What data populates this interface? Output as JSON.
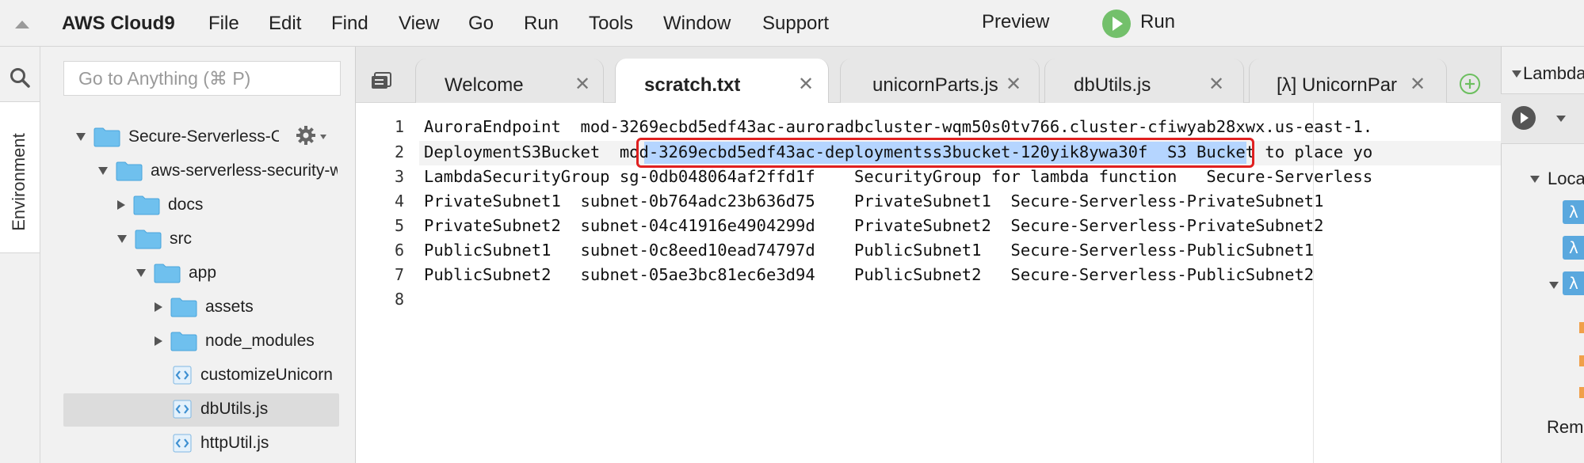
{
  "menubar": {
    "app_title": "AWS Cloud9",
    "items": [
      "File",
      "Edit",
      "Find",
      "View",
      "Go",
      "Run",
      "Tools",
      "Window",
      "Support"
    ],
    "preview_label": "Preview",
    "run_label": "Run"
  },
  "sidebar": {
    "environment_tab": "Environment",
    "goto_placeholder": "Go to Anything (⌘ P)",
    "tree": [
      {
        "label": "Secure-Serverless-C",
        "type": "folder",
        "state": "expanded"
      },
      {
        "label": "aws-serverless-security-w",
        "type": "folder",
        "state": "expanded"
      },
      {
        "label": "docs",
        "type": "folder",
        "state": "collapsed"
      },
      {
        "label": "src",
        "type": "folder",
        "state": "expanded"
      },
      {
        "label": "app",
        "type": "folder",
        "state": "expanded"
      },
      {
        "label": "assets",
        "type": "folder",
        "state": "collapsed"
      },
      {
        "label": "node_modules",
        "type": "folder",
        "state": "collapsed"
      },
      {
        "label": "customizeUnicorn",
        "type": "file"
      },
      {
        "label": "dbUtils.js",
        "type": "file",
        "selected": true
      },
      {
        "label": "httpUtil.js",
        "type": "file"
      }
    ]
  },
  "tabs": [
    {
      "label": "Welcome",
      "active": false
    },
    {
      "label": "scratch.txt",
      "active": true
    },
    {
      "label": "unicornParts.js",
      "active": false
    },
    {
      "label": "dbUtils.js",
      "active": false
    },
    {
      "label": "[λ] UnicornPar",
      "active": false
    }
  ],
  "editor": {
    "lines": [
      {
        "no": "1",
        "text": "AuroraEndpoint  mod-3269ecbd5edf43ac-auroradbcluster-wqm50s0tv766.cluster-cfiwyab28xwx.us-east-1."
      },
      {
        "no": "2",
        "text": "DeploymentS3Bucket  mod-3269ecbd5edf43ac-deploymentss3bucket-120yik8ywa30f  S3 Bucket to place yo"
      },
      {
        "no": "3",
        "text": "LambdaSecurityGroup sg-0db048064af2ffd1f    SecurityGroup for lambda function   Secure-Serverless"
      },
      {
        "no": "4",
        "text": "PrivateSubnet1  subnet-0b764adc23b636d75    PrivateSubnet1  Secure-Serverless-PrivateSubnet1"
      },
      {
        "no": "5",
        "text": "PrivateSubnet2  subnet-04c41916e4904299d    PrivateSubnet2  Secure-Serverless-PrivateSubnet2"
      },
      {
        "no": "6",
        "text": "PublicSubnet1   subnet-0c8eed10ead74797d    PublicSubnet1   Secure-Serverless-PublicSubnet1"
      },
      {
        "no": "7",
        "text": "PublicSubnet2   subnet-05ae3bc81ec6e3d94    PublicSubnet2   Secure-Serverless-PublicSubnet2"
      },
      {
        "no": "8",
        "text": ""
      }
    ],
    "selected_text": "mod-3269ecbd5edf43ac-deploymentss3bucket-120yik8ywa30f"
  },
  "right_panel": {
    "title": "Lambda",
    "local_label": "Local",
    "lambda_icon": "λ",
    "remote_label": "Remo"
  },
  "colors": {
    "run_green": "#73c06b",
    "selection_blue": "#b5d5ff",
    "callout_red": "#e02020",
    "folder_blue": "#6fc0ee"
  }
}
